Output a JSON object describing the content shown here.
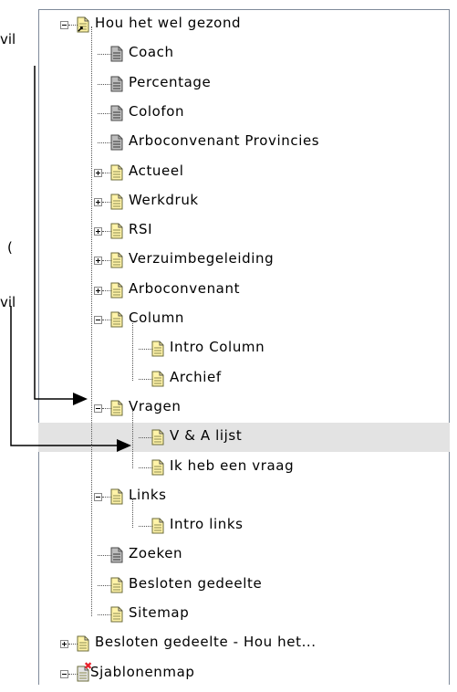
{
  "clipped_left_text": [
    "vil",
    "(",
    "vil"
  ],
  "tree": [
    {
      "label": "Hou het wel gezond",
      "icon": "page-shortcut-icon",
      "toggle": "minus"
    },
    {
      "label": "Coach",
      "icon": "grey-page-icon"
    },
    {
      "label": "Percentage",
      "icon": "grey-page-icon"
    },
    {
      "label": "Colofon",
      "icon": "grey-page-icon"
    },
    {
      "label": "Arboconvenant Provincies",
      "icon": "grey-page-icon"
    },
    {
      "label": "Actueel",
      "icon": "yellow-page-icon",
      "toggle": "plus"
    },
    {
      "label": "Werkdruk",
      "icon": "yellow-page-icon",
      "toggle": "plus"
    },
    {
      "label": "RSI",
      "icon": "yellow-page-icon",
      "toggle": "plus"
    },
    {
      "label": "Verzuimbegeleiding",
      "icon": "yellow-page-icon",
      "toggle": "plus"
    },
    {
      "label": "Arboconvenant",
      "icon": "yellow-page-icon",
      "toggle": "plus"
    },
    {
      "label": "Column",
      "icon": "yellow-page-icon",
      "toggle": "minus"
    },
    {
      "label": "Intro Column",
      "icon": "yellow-page-icon"
    },
    {
      "label": "Archief",
      "icon": "yellow-page-icon"
    },
    {
      "label": "Vragen",
      "icon": "yellow-page-icon",
      "toggle": "minus"
    },
    {
      "label": "V & A lijst",
      "icon": "yellow-page-icon",
      "selected": true
    },
    {
      "label": "Ik heb een vraag",
      "icon": "yellow-page-icon"
    },
    {
      "label": "Links",
      "icon": "yellow-page-icon",
      "toggle": "minus"
    },
    {
      "label": "Intro links",
      "icon": "yellow-page-icon"
    },
    {
      "label": "Zoeken",
      "icon": "grey-page-icon"
    },
    {
      "label": "Besloten gedeelte",
      "icon": "yellow-page-icon"
    },
    {
      "label": "Sitemap",
      "icon": "yellow-page-icon"
    },
    {
      "label": "Besloten gedeelte - Hou het...",
      "icon": "yellow-page-icon",
      "toggle": "plus"
    },
    {
      "label": "Sjablonenmap",
      "icon": "template-folder-icon",
      "toggle": "minus"
    }
  ],
  "colors": {
    "selected_row": "#e3e3e3",
    "page_yellow": "#fff3a8",
    "page_grey": "#bdbdbd",
    "remove_x": "#e8202a"
  }
}
